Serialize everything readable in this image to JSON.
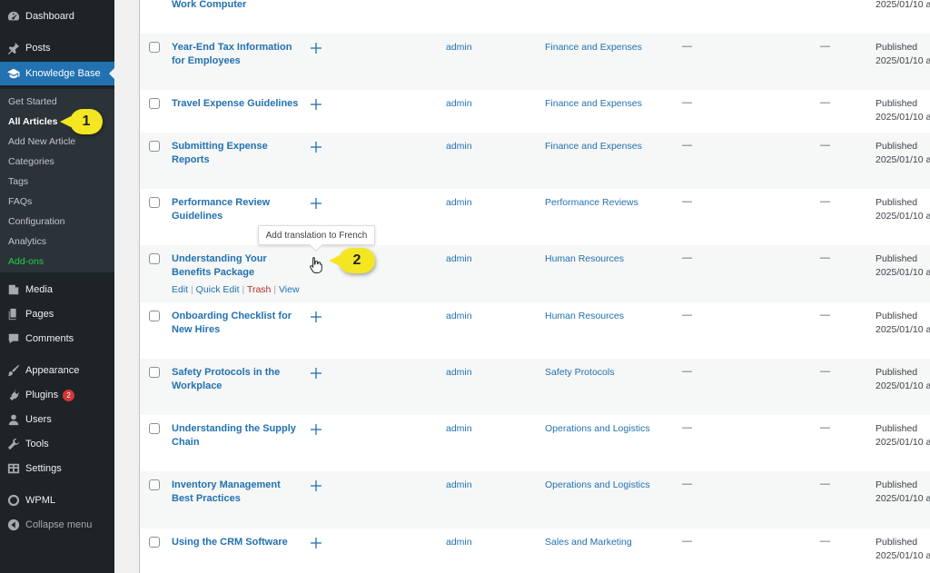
{
  "sidebar": {
    "dashboard": "Dashboard",
    "posts": "Posts",
    "knowledge_base": "Knowledge Base",
    "submenu": {
      "get_started": "Get Started",
      "all_articles": "All Articles",
      "add_new_article": "Add New Article",
      "categories": "Categories",
      "tags": "Tags",
      "faqs": "FAQs",
      "configuration": "Configuration",
      "analytics": "Analytics",
      "add_ons": "Add-ons"
    },
    "media": "Media",
    "pages": "Pages",
    "comments": "Comments",
    "appearance": "Appearance",
    "plugins": "Plugins",
    "plugins_badge": "2",
    "users": "Users",
    "tools": "Tools",
    "settings": "Settings",
    "wpml": "WPML",
    "collapse": "Collapse menu"
  },
  "table": {
    "top_row_title": "Work Computer",
    "top_row_date": "2025/01/10 a",
    "rows": [
      {
        "title": "Year-End Tax Information for Employees",
        "author": "admin",
        "category": "Finance and Expenses",
        "col1": "—",
        "col2": "—",
        "status": "Published",
        "date": "2025/01/10 a"
      },
      {
        "title": "Travel Expense Guidelines",
        "author": "admin",
        "category": "Finance and Expenses",
        "col1": "—",
        "col2": "—",
        "status": "Published",
        "date": "2025/01/10 a"
      },
      {
        "title": "Submitting Expense Reports",
        "author": "admin",
        "category": "Finance and Expenses",
        "col1": "—",
        "col2": "—",
        "status": "Published",
        "date": "2025/01/10 a"
      },
      {
        "title": "Performance Review Guidelines",
        "author": "admin",
        "category": "Performance Reviews",
        "col1": "—",
        "col2": "—",
        "status": "Published",
        "date": "2025/01/10 a"
      },
      {
        "title": "Understanding Your Benefits Package",
        "author": "admin",
        "category": "Human Resources",
        "col1": "—",
        "col2": "—",
        "status": "Published",
        "date": "2025/01/10 a"
      },
      {
        "title": "Onboarding Checklist for New Hires",
        "author": "admin",
        "category": "Human Resources",
        "col1": "—",
        "col2": "—",
        "status": "Published",
        "date": "2025/01/10 a"
      },
      {
        "title": "Safety Protocols in the Workplace",
        "author": "admin",
        "category": "Safety Protocols",
        "col1": "—",
        "col2": "—",
        "status": "Published",
        "date": "2025/01/10 a"
      },
      {
        "title": "Understanding the Supply Chain",
        "author": "admin",
        "category": "Operations and Logistics",
        "col1": "—",
        "col2": "—",
        "status": "Published",
        "date": "2025/01/10 a"
      },
      {
        "title": "Inventory Management Best Practices",
        "author": "admin",
        "category": "Operations and Logistics",
        "col1": "—",
        "col2": "—",
        "status": "Published",
        "date": "2025/01/10 a"
      },
      {
        "title": "Using the CRM Software",
        "author": "admin",
        "category": "Sales and Marketing",
        "col1": "—",
        "col2": "—",
        "status": "Published",
        "date": "2025/01/10 a"
      }
    ],
    "row_actions": {
      "edit": "Edit",
      "quick_edit": "Quick Edit",
      "trash": "Trash",
      "view": "View",
      "separator": "|"
    }
  },
  "tooltip": "Add translation to French",
  "callouts": {
    "one": "1",
    "two": "2"
  },
  "icons": {
    "dashboard": "dashboard-icon",
    "posts": "pin-icon",
    "knowledge_base": "graduation-cap-icon",
    "media": "media-icon",
    "pages": "pages-icon",
    "comments": "comment-icon",
    "appearance": "brush-icon",
    "plugins": "plugin-icon",
    "users": "user-icon",
    "tools": "wrench-icon",
    "settings": "settings-icon",
    "wpml": "wpml-icon",
    "collapse": "collapse-icon",
    "add_translation": "plus-icon",
    "cursor": "hand-cursor-icon"
  },
  "colors": {
    "sidebar_bg": "#1d2327",
    "active_bg": "#2271b1",
    "link": "#2271b1",
    "callout": "#f5e623",
    "addon": "#1ed14b",
    "badge": "#d63638"
  }
}
